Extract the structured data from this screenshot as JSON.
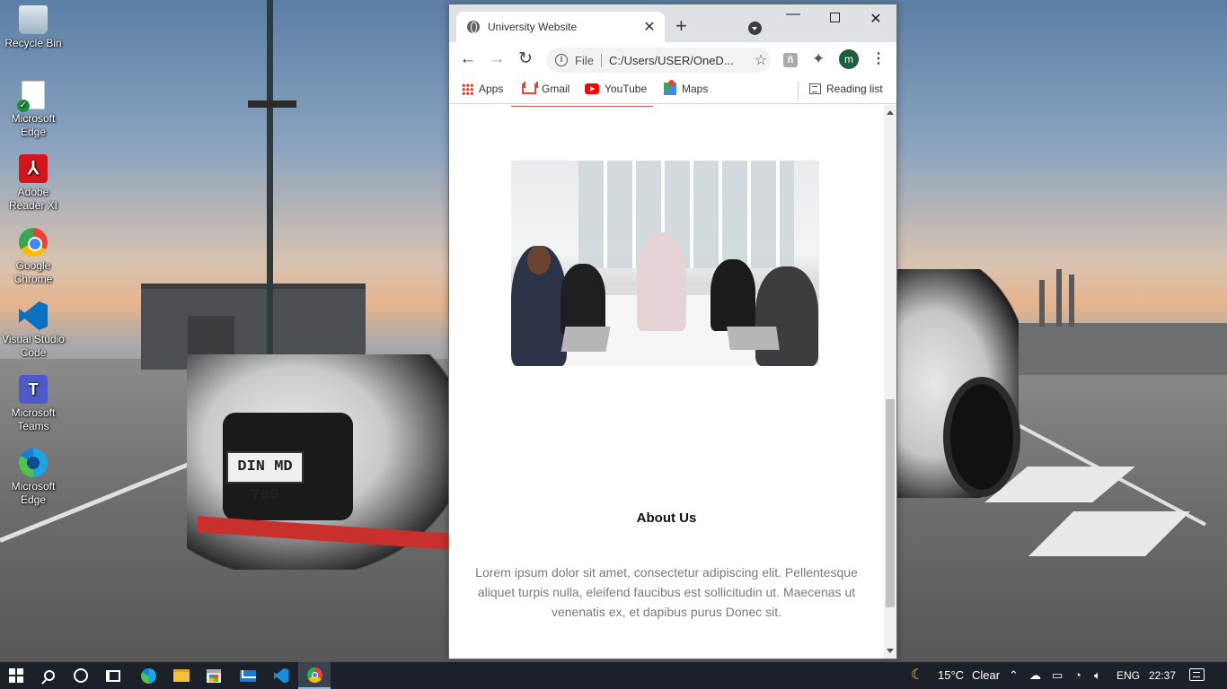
{
  "desktop": {
    "icons": [
      {
        "label": "Recycle Bin",
        "icon": "recycle-bin-icon"
      },
      {
        "label": "Microsoft Edge",
        "icon": "edge-document-icon"
      },
      {
        "label": "Adobe Reader XI",
        "icon": "adobe-reader-icon"
      },
      {
        "label": "Google Chrome",
        "icon": "chrome-icon"
      },
      {
        "label": "Visual Studio Code",
        "icon": "vscode-icon"
      },
      {
        "label": "Microsoft Teams",
        "icon": "teams-icon"
      },
      {
        "label": "Microsoft Edge",
        "icon": "edge-icon"
      }
    ],
    "wallpaper_plate": "DIN MD 700"
  },
  "browser": {
    "tab_title": "University Website",
    "omnibox": {
      "scheme_label": "File",
      "url": "C:/Users/USER/OneD..."
    },
    "profile_initial": "m",
    "bookmarks": [
      {
        "label": "Apps",
        "icon": "apps-grid-icon"
      },
      {
        "label": "Gmail",
        "icon": "gmail-icon"
      },
      {
        "label": "YouTube",
        "icon": "youtube-icon"
      },
      {
        "label": "Maps",
        "icon": "maps-icon"
      }
    ],
    "reading_list": "Reading list",
    "colors": {
      "tabbar": "#dee1e6",
      "profile": "#1a5c3d"
    }
  },
  "page": {
    "about_title": "About Us",
    "about_text": "Lorem ipsum dolor sit amet, consectetur adipiscing elit. Pellentesque aliquet turpis nulla, eleifend faucibus est sollicitudin ut. Maecenas ut venenatis ex, et dapibus purus Donec sit.",
    "image_description_icon": "team-meeting-photo"
  },
  "taskbar": {
    "weather_temp": "15°C",
    "weather_cond": "Clear",
    "language": "ENG",
    "time": "22:37"
  }
}
